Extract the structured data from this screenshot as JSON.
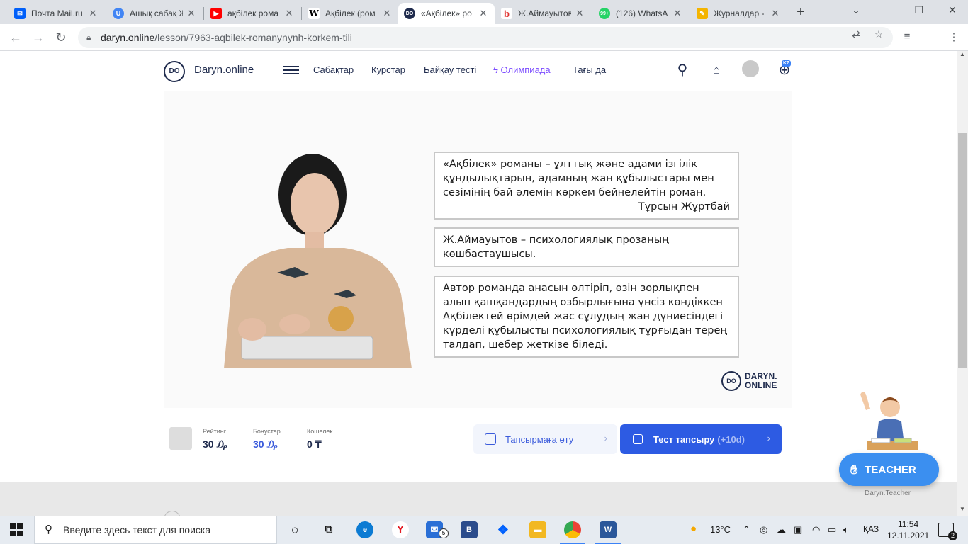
{
  "browser": {
    "tabs": [
      {
        "label": "Почта Mail.ru",
        "icon": "mail-ru-icon",
        "color": "#005ff9"
      },
      {
        "label": "Ашық сабақ Ж",
        "icon": "u-letter-icon",
        "color": "#4285f4"
      },
      {
        "label": "ақбілек рома",
        "icon": "youtube-icon",
        "color": "#ff0000"
      },
      {
        "label": "Ақбілек (ром",
        "icon": "wikipedia-icon",
        "color": "#000000"
      },
      {
        "label": "«Ақбілек» ро",
        "icon": "daryn-online-icon",
        "color": "#1f2b4d"
      },
      {
        "label": "Ж.Аймауытов",
        "icon": "b-letter-icon",
        "color": "#e0312e"
      },
      {
        "label": "(126) WhatsA",
        "icon": "whatsapp-icon",
        "color": "#25d366"
      },
      {
        "label": "Журналдар -",
        "icon": "journal-icon",
        "color": "#f4b400"
      }
    ],
    "url_host": "daryn.online",
    "url_path": "/lesson/7963-aqbilek-romanynynh-korkem-tili"
  },
  "site": {
    "logo_mark": "DO",
    "name": "Daryn.online",
    "nav": {
      "lessons": "Сабақтар",
      "courses": "Курстар",
      "trial": "Байқау тесті",
      "olympiad": "Олимпиада",
      "more": "Тағы да"
    },
    "lang_badge": "KZ"
  },
  "lesson": {
    "quote": {
      "text": "«Ақбілек» романы – ұлттық және адами ізгілік құндылықтарын, адамның жан құбылыстары мен сезімінің бай әлемін көркем бейнелейтін роман.",
      "author": "Тұрсын Жұртбай"
    },
    "note1": "Ж.Аймауытов – психологиялық прозаның көшбастаушысы.",
    "note2": "Автор романда анасын өлтіріп, өзін зорлықпен алып қашқандардың озбырлығына үнсіз көндіккен Ақбілектей өрімдей жас сұлудың жан дүниесіндегі күрделі құбылысты психологиялық тұрғыдан терең талдап, шебер жеткізе біледі.",
    "video_logo_mark": "DO",
    "video_logo_line1": "DARYN.",
    "video_logo_line2": "ONLINE"
  },
  "stats": {
    "rating_label": "Рейтинг",
    "rating_value": "30 ₯",
    "bonus_label": "Бонустар",
    "bonus_value": "30 ₯",
    "wallet_label": "Кошелек",
    "wallet_value": "0 ₸",
    "task_button": "Тапсырмаға өту",
    "test_button": "Тест тапсыру",
    "test_bonus": "(+10d)"
  },
  "teacher": {
    "button": "TEACHER",
    "caption": "Daryn.Teacher"
  },
  "taskbar": {
    "search_placeholder": "Введите здесь текст для поиска",
    "mail_badge": "5",
    "weather": "13°C",
    "lang": "ҚАЗ",
    "time": "11:54",
    "date": "12.11.2021",
    "notifications": "2"
  },
  "colors": {
    "accent_blue": "#2d5be3",
    "teacher_blue": "#3b8ff0",
    "olympiad_purple": "#7b4bff",
    "brand_navy": "#1f2b4d"
  }
}
